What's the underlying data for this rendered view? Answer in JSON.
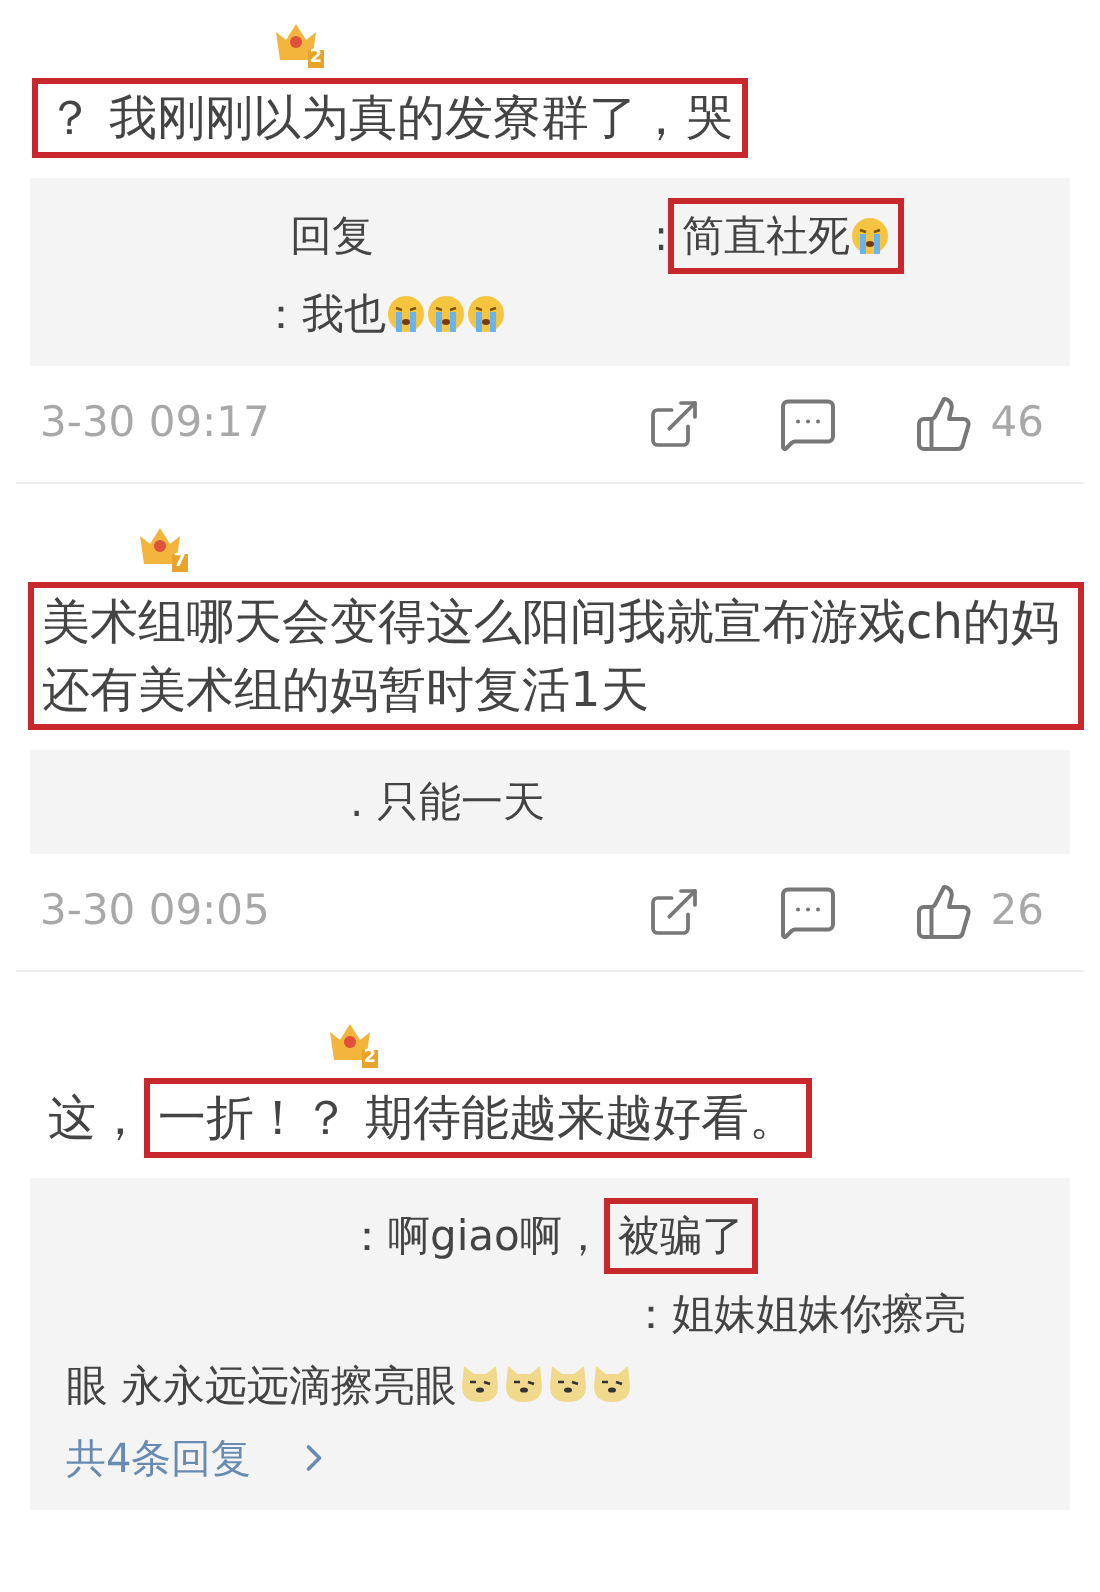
{
  "comments": [
    {
      "badge": "2",
      "runs": [
        {
          "highlighted": true,
          "parts": [
            {
              "kind": "text",
              "text": "？ 我刚刚以为真的发寮群了，哭"
            }
          ]
        }
      ],
      "replies": [
        {
          "runs": [
            {
              "highlighted": false,
              "parts": [
                {
                  "kind": "text",
                  "text": "回复"
                }
              ]
            },
            {
              "highlighted": false,
              "parts": [
                {
                  "kind": "text",
                  "text": ":"
                }
              ]
            },
            {
              "highlighted": true,
              "parts": [
                {
                  "kind": "text",
                  "text": "简直社死"
                },
                {
                  "kind": "crying"
                }
              ]
            }
          ]
        },
        {
          "runs": [
            {
              "highlighted": false,
              "parts": [
                {
                  "kind": "text",
                  "text": "：我也"
                },
                {
                  "kind": "crying"
                },
                {
                  "kind": "crying"
                },
                {
                  "kind": "crying"
                }
              ]
            }
          ]
        }
      ],
      "time": "3-30 09:17",
      "likes": "46"
    },
    {
      "badge": "7",
      "runs": [
        {
          "highlighted": true,
          "parts": [
            {
              "kind": "text",
              "text": "美术组哪天会变得这么阳间我就宣布游戏ch的妈还有美术组的妈暂时复活1天"
            }
          ]
        }
      ],
      "replies": [
        {
          "runs": [
            {
              "highlighted": false,
              "parts": [
                {
                  "kind": "text",
                  "text": ". 只能一天"
                }
              ]
            }
          ]
        }
      ],
      "time": "3-30 09:05",
      "likes": "26"
    },
    {
      "badge": "2",
      "runs": [
        {
          "highlighted": false,
          "parts": [
            {
              "kind": "text",
              "text": "这，"
            }
          ]
        },
        {
          "highlighted": true,
          "parts": [
            {
              "kind": "text",
              "text": "一折！？ 期待能越来越好看。"
            }
          ]
        }
      ],
      "replies": [
        {
          "runs": [
            {
              "highlighted": false,
              "parts": [
                {
                  "kind": "text",
                  "text": "：啊giao啊，"
                }
              ]
            },
            {
              "highlighted": true,
              "parts": [
                {
                  "kind": "text",
                  "text": "被骗了"
                }
              ]
            }
          ]
        },
        {
          "runs": [
            {
              "highlighted": false,
              "parts": [
                {
                  "kind": "text",
                  "text": "：姐妹姐妹你擦亮"
                }
              ]
            }
          ]
        },
        {
          "runs": [
            {
              "highlighted": false,
              "parts": [
                {
                  "kind": "text",
                  "text": "眼 永永远远滴擦亮眼"
                },
                {
                  "kind": "dog"
                },
                {
                  "kind": "dog"
                },
                {
                  "kind": "dog"
                },
                {
                  "kind": "dog"
                }
              ]
            }
          ]
        }
      ],
      "more": "共4条回复"
    }
  ]
}
